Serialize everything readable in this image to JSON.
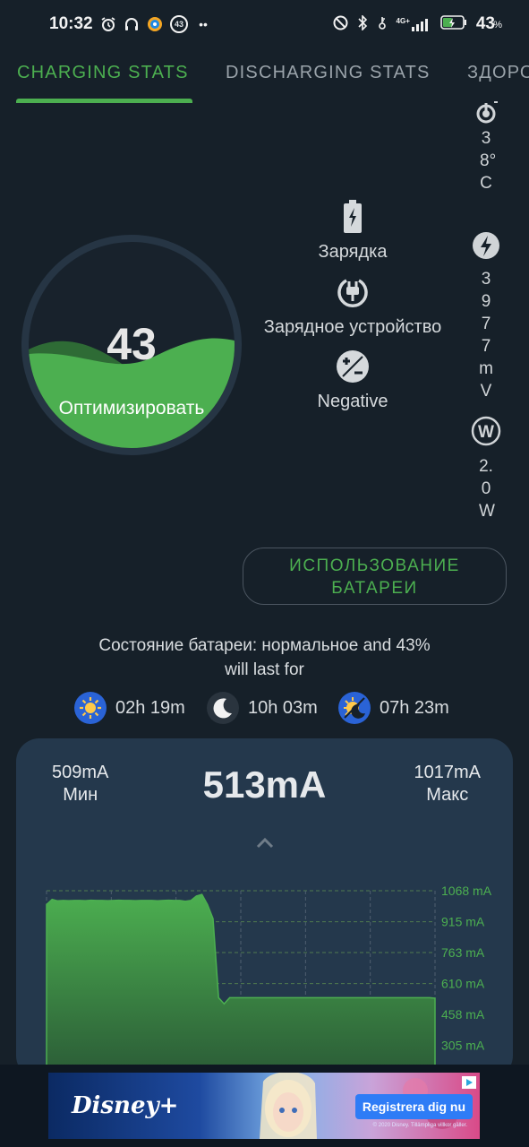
{
  "status_bar": {
    "time": "10:32",
    "notif_badge": "43",
    "more": "••",
    "network": "4G+",
    "battery_level": "43",
    "battery_unit": "%"
  },
  "tabs": [
    {
      "label": "CHARGING STATS",
      "active": true
    },
    {
      "label": "DISCHARGING STATS",
      "active": false
    },
    {
      "label": "ЗДОРО",
      "active": false
    }
  ],
  "gauge": {
    "level": 43,
    "value_text": "43",
    "action_label": "Оптимизировать"
  },
  "info": {
    "charging_label": "Зарядка",
    "charger_label": "Зарядное устройство",
    "polarity_label": "Negative"
  },
  "vitals": {
    "temperature": "38°C",
    "voltage": "3977mV",
    "power": "2.0W"
  },
  "usage_button": {
    "line1": "ИСПОЛЬЗОВАНИЕ",
    "line2": "БАТАРЕИ"
  },
  "health": {
    "line1": "Состояние батареи: нормальное and 43%",
    "line2": "will last for"
  },
  "estimates": [
    {
      "icon": "sun-icon",
      "value": "02h 19m"
    },
    {
      "icon": "moon-icon",
      "value": "10h 03m"
    },
    {
      "icon": "day-night-icon",
      "value": "07h 23m"
    }
  ],
  "current_card": {
    "min_value": "509mA",
    "min_label": "Мин",
    "current_value": "513mA",
    "max_value": "1017mA",
    "max_label": "Макс"
  },
  "chart_data": {
    "type": "area",
    "y_unit": "mA",
    "ylim": [
      300,
      1068
    ],
    "y_ticks": [
      "1068 mA",
      "915 mA",
      "763 mA",
      "610 mA",
      "458 mA",
      "305 mA"
    ],
    "y_tick_values": [
      1068,
      915,
      763,
      610,
      458,
      305
    ],
    "grid": true,
    "series_color": "#4caf50",
    "values": [
      1000,
      1025,
      1018,
      1020,
      1019,
      1020,
      1020,
      1019,
      1021,
      1020,
      1020,
      1019,
      1020,
      1021,
      1020,
      1020,
      1019,
      1020,
      1020,
      1020,
      1018,
      1020,
      1021,
      1020,
      1020,
      1016,
      1020,
      1042,
      1050,
      1000,
      930,
      540,
      510,
      540,
      540,
      540,
      540,
      540,
      540,
      540,
      540,
      540,
      540,
      540,
      540,
      540,
      540,
      540,
      540,
      540,
      540,
      540,
      540,
      540,
      540,
      540,
      540,
      540,
      540,
      540,
      540,
      540,
      540,
      540,
      540,
      540,
      540,
      540,
      540,
      540,
      538
    ]
  },
  "ad": {
    "brand": "Disney+",
    "cta": "Registrera dig nu",
    "fine_print": "© 2020 Disney. Tillämpliga villkor gäller."
  }
}
